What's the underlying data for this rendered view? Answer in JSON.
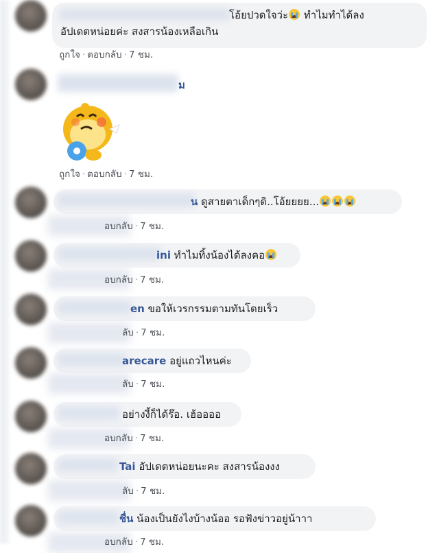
{
  "comments": [
    {
      "name": "",
      "text": "โอ้ยปวดใจว่ะ",
      "text_line2": "อัปเดตหน่อยค่ะ สงสารน้องเหลือเกิน",
      "text_after_emoji": " ทำไมทำได้ลง",
      "like": "ถูกใจ",
      "reply": "ตอบกลับ",
      "time": "7 ชม."
    },
    {
      "name": "ม",
      "sticker": "crying-yellow-dinosaur-sticker",
      "like": "ถูกใจ",
      "reply": "ตอบกลับ",
      "time": "7 ชม."
    },
    {
      "name": "น",
      "text": "ดูสายตาเด็กๆดิ..โอ้ยยยย...",
      "reply": "อบกลับ",
      "time": "7 ชม."
    },
    {
      "name": "ini",
      "text": "ทำไมทิ้งน้องได้ลงคอ",
      "reply": "อบกลับ",
      "time": "7 ชม."
    },
    {
      "name": "en",
      "text": "ขอให้เวรกรรมตามทันโดยเร็ว",
      "reply": "ลับ",
      "time": "7 ชม."
    },
    {
      "name": "arecare",
      "text": "อยู่แถวไหนค่ะ",
      "reply": "ลับ",
      "time": "7 ชม."
    },
    {
      "name": "",
      "text": "อย่างงี้ก็ได้ร๊อ. เฮ้ออออ",
      "reply": "อบกลับ",
      "time": "7 ชม."
    },
    {
      "name": "Tai",
      "text": "อัปเดตหน่อยนะคะ สงสารน้องงง",
      "reply": "ลับ",
      "time": "7 ชม."
    },
    {
      "name": "ชื่น",
      "text": "น้องเป็นยังไงบ้างน้ออ รอฟังข่าวอยู่น้าาา",
      "reply": "อบกลับ",
      "time": "7 ชม."
    }
  ],
  "colors": {
    "bubble": "#f2f3f5",
    "name": "#385898",
    "text": "#1c1e21",
    "meta": "#4b4f56"
  },
  "icons": {
    "emoji": "crying-face-emoji"
  }
}
